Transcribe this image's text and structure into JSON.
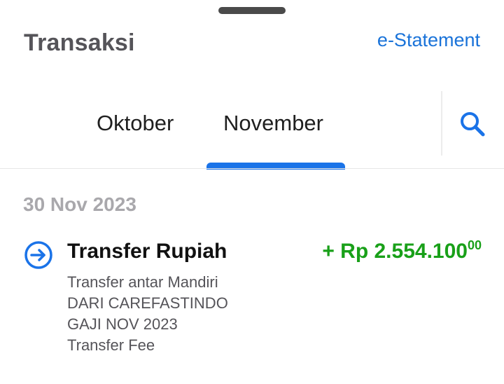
{
  "header": {
    "title": "Transaksi",
    "estatement_label": "e-Statement"
  },
  "tabs": [
    {
      "label": "Oktober",
      "active": false
    },
    {
      "label": "November",
      "active": true
    }
  ],
  "colors": {
    "accent": "#1a73e8",
    "amount_positive": "#19a019"
  },
  "icons": {
    "search": "search-icon",
    "transfer": "arrow-in-circle-icon"
  },
  "transactions": [
    {
      "date": "30 Nov 2023",
      "title": "Transfer Rupiah",
      "amount_main": "+ Rp 2.554.100",
      "amount_cents": "00",
      "description": [
        "Transfer antar Mandiri",
        "DARI CAREFASTINDO",
        "GAJI NOV 2023",
        "Transfer Fee"
      ]
    }
  ]
}
